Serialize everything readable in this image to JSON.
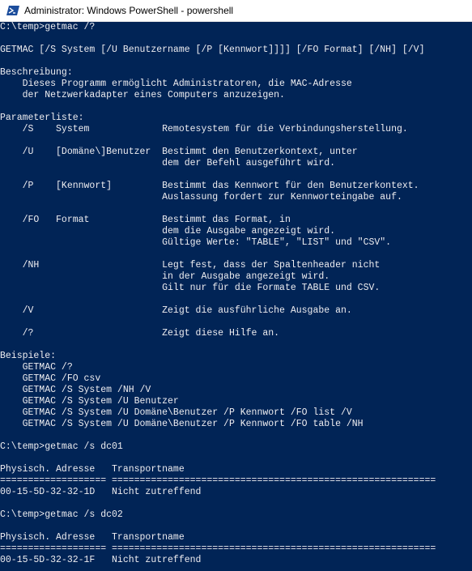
{
  "window": {
    "title": "Administrator: Windows PowerShell - powershell"
  },
  "icons": {
    "app_icon": "powershell-icon"
  },
  "colors": {
    "console_background": "#012456",
    "console_foreground": "#eeedf0",
    "titlebar_background": "#ffffff",
    "icon_blue": "#1c4d9c"
  },
  "console": {
    "lines": [
      "C:\\temp>getmac /?",
      "",
      "GETMAC [/S System [/U Benutzername [/P [Kennwort]]]] [/FO Format] [/NH] [/V]",
      "",
      "Beschreibung:",
      "    Dieses Programm ermöglicht Administratoren, die MAC-Adresse",
      "    der Netzwerkadapter eines Computers anzuzeigen.",
      "",
      "Parameterliste:",
      "    /S    System             Remotesystem für die Verbindungsherstellung.",
      "",
      "    /U    [Domäne\\]Benutzer  Bestimmt den Benutzerkontext, unter",
      "                             dem der Befehl ausgeführt wird.",
      "",
      "    /P    [Kennwort]         Bestimmt das Kennwort für den Benutzerkontext.",
      "                             Auslassung fordert zur Kennworteingabe auf.",
      "",
      "    /FO   Format             Bestimmt das Format, in",
      "                             dem die Ausgabe angezeigt wird.",
      "                             Gültige Werte: \"TABLE\", \"LIST\" und \"CSV\".",
      "",
      "    /NH                      Legt fest, dass der Spaltenheader nicht",
      "                             in der Ausgabe angezeigt wird.",
      "                             Gilt nur für die Formate TABLE und CSV.",
      "",
      "    /V                       Zeigt die ausführliche Ausgabe an.",
      "",
      "    /?                       Zeigt diese Hilfe an.",
      "",
      "Beispiele:",
      "    GETMAC /?",
      "    GETMAC /FO csv",
      "    GETMAC /S System /NH /V",
      "    GETMAC /S System /U Benutzer",
      "    GETMAC /S System /U Domäne\\Benutzer /P Kennwort /FO list /V",
      "    GETMAC /S System /U Domäne\\Benutzer /P Kennwort /FO table /NH",
      "",
      "C:\\temp>getmac /s dc01",
      "",
      "Physisch. Adresse   Transportname",
      "=================== ==========================================================",
      "00-15-5D-32-32-1D   Nicht zutreffend",
      "",
      "C:\\temp>getmac /s dc02",
      "",
      "Physisch. Adresse   Transportname",
      "=================== ==========================================================",
      "00-15-5D-32-32-1F   Nicht zutreffend"
    ]
  }
}
